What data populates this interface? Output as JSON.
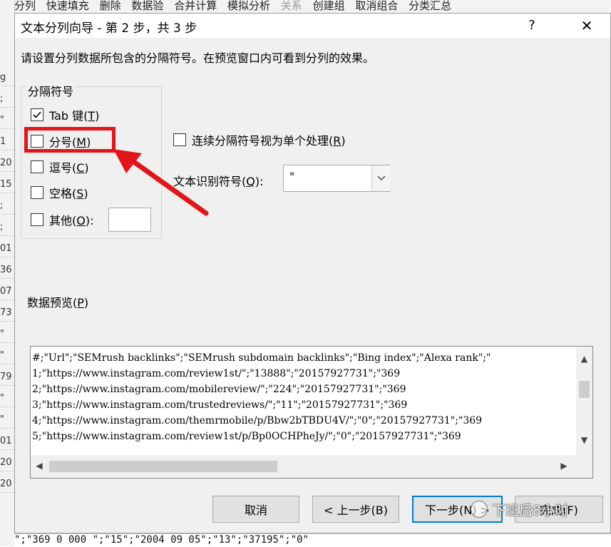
{
  "background": {
    "ribbon_items": [
      "分列",
      "快速填充",
      "删除",
      "数据验",
      "合并计算",
      "模拟分析",
      "关系",
      "创建组",
      "取消组合",
      "分类汇总"
    ],
    "left_cells": [
      "g",
      ";",
      "\"",
      "1",
      "20",
      "15",
      ";",
      ";",
      "01",
      "36",
      "07",
      "73",
      "\"",
      "\"",
      "79",
      "\"",
      "\"",
      "01",
      "20",
      "20"
    ],
    "bottom_row_text": "\";\"369  0 000 \";\"15\";\"2004 09 05\";\"13\";\"37195\";\"0\""
  },
  "dialog": {
    "title": "文本分列向导 - 第 2 步，共 3 步",
    "help_label": "?",
    "close_label": "✕",
    "instruction": "请设置分列数据所包含的分隔符号。在预览窗口内可看到分列的效果。"
  },
  "delimiters": {
    "legend": "分隔符号",
    "tab": {
      "label": "Tab 键(",
      "key": "T",
      "suffix": ")",
      "checked": true
    },
    "semicolon": {
      "label": "分号(",
      "key": "M",
      "suffix": ")",
      "checked": false
    },
    "comma": {
      "label": "逗号(",
      "key": "C",
      "suffix": ")",
      "checked": false
    },
    "space": {
      "label": "空格(",
      "key": "S",
      "suffix": ")",
      "checked": false
    },
    "other": {
      "label": "其他(",
      "key": "O",
      "suffix": "):",
      "checked": false,
      "value": ""
    }
  },
  "consecutive": {
    "label": "连续分隔符号视为单个处理(",
    "key": "R",
    "suffix": ")",
    "checked": false
  },
  "qualifier": {
    "label": "文本识别符号(",
    "key": "Q",
    "suffix": "):",
    "value": "\""
  },
  "preview": {
    "label": "数据预览(",
    "key": "P",
    "suffix": ")",
    "lines": [
      "#;\"Url\";\"SEMrush backlinks\";\"SEMrush subdomain backlinks\";\"Bing index\";\"Alexa rank\";\"",
      "1;\"https://www.instagram.com/review1st/\";\"13888\";\"20157927731\";\"369",
      "2;\"https://www.instagram.com/mobilereview/\";\"224\";\"20157927731\";\"369",
      "3;\"https://www.instagram.com/trustedreviews/\";\"11\";\"20157927731\";\"369",
      "4;\"https://www.instagram.com/themrmobile/p/Bbw2bTBDU4V/\";\"0\";\"20157927731\";\"369",
      "5;\"https://www.instagram.com/review1st/p/Bp0OCHPheJy/\";\"0\";\"20157927731\";\"369"
    ]
  },
  "buttons": {
    "cancel": "取消",
    "back": "< 上一步(B)",
    "next": "下一步(N) >",
    "finish": "完成(F)"
  },
  "watermark": "下班后8小时",
  "colors": {
    "highlight": "#e0161b",
    "focus": "#0078d7"
  }
}
